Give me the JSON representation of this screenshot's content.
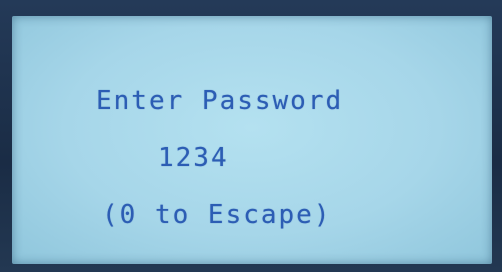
{
  "display": {
    "line1": "Enter Password",
    "line2": "1234",
    "line3": "(0 to Escape)"
  },
  "colors": {
    "screen_background": "#a8d8ea",
    "text": "#2c5db4",
    "bezel": "#1c2f49"
  }
}
